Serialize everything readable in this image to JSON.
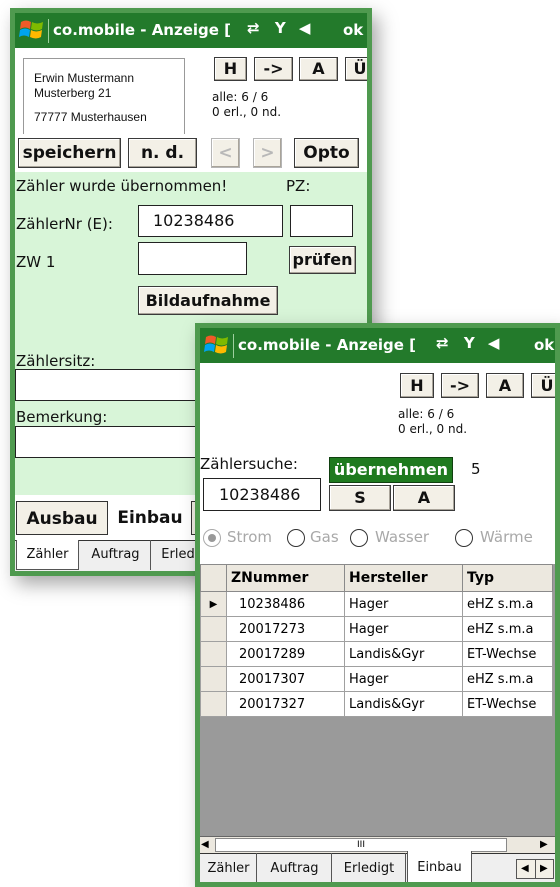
{
  "app_title": "co.mobile - Anzeige [",
  "ok_label": "ok",
  "status_icons": {
    "sync": "⇄",
    "signal": "Y",
    "volume": "◀"
  },
  "screen1": {
    "address": {
      "name": "Erwin Mustermann",
      "street": "Musterberg 21",
      "city": "77777  Musterhausen"
    },
    "nav_buttons": [
      "H",
      "->",
      "A",
      "Ü"
    ],
    "counts_line1": "alle: 6 / 6",
    "counts_line2": "0 erl., 0 nd.",
    "toolbar": {
      "save": "speichern",
      "nd": "n. d.",
      "prev": "<",
      "next": ">",
      "opto": "Opto"
    },
    "message": "Zähler wurde übernommen!",
    "pz_label": "PZ:",
    "meter_label": "ZählerNr (E):",
    "meter_value": "10238486",
    "pz_value": "",
    "zw_label": "ZW 1",
    "zw_value": "",
    "check_button": "prüfen",
    "photo_button": "Bildaufnahme",
    "location_label": "Zählersitz:",
    "remark_label": "Bemerkung:",
    "upper_tabs": [
      "Ausbau",
      "Einbau"
    ],
    "lower_tabs": [
      "Zähler",
      "Auftrag",
      "Erled"
    ]
  },
  "screen2": {
    "nav_buttons": [
      "H",
      "->",
      "A",
      "Ü"
    ],
    "counts_line1": "alle: 6 / 6",
    "counts_line2": "0 erl., 0 nd.",
    "search_label": "Zählersuche:",
    "search_value": "10238486",
    "apply_button": "übernehmen",
    "result_count": "5",
    "s_button": "S",
    "a_button": "A",
    "radio_options": [
      "Strom",
      "Gas",
      "Wasser",
      "Wärme"
    ],
    "selected_radio": "Strom",
    "table": {
      "columns": [
        "ZNummer",
        "Hersteller",
        "Typ"
      ],
      "rows": [
        [
          "10238486",
          "Hager",
          "eHZ s.m.a"
        ],
        [
          "20017273",
          "Hager",
          "eHZ s.m.a"
        ],
        [
          "20017289",
          "Landis&Gyr",
          "ET-Wechse"
        ],
        [
          "20017307",
          "Hager",
          "eHZ s.m.a"
        ],
        [
          "20017327",
          "Landis&Gyr",
          "ET-Wechse"
        ]
      ],
      "current_row_marker": "▶"
    },
    "scroll_thumb": "III",
    "tabs": [
      "Zähler",
      "Auftrag",
      "Erledigt",
      "Einbau"
    ],
    "selected_tab": "Einbau"
  },
  "colors": {
    "titlebar": "#237a2b",
    "frame": "#4f9a4f",
    "panel": "#d8f5d8",
    "apply_button": "#1f7a1f"
  }
}
